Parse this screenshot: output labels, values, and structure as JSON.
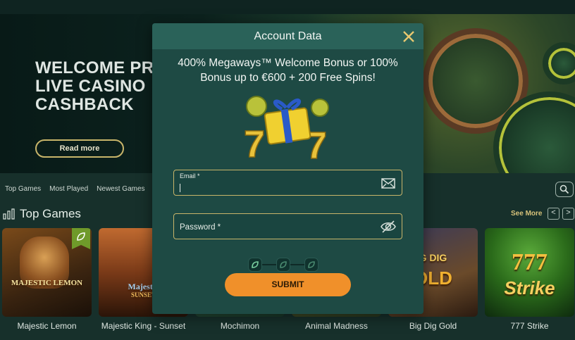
{
  "hero": {
    "headline_lines": [
      "WELCOME PRE",
      "LIVE CASINO",
      "CASHBACK"
    ],
    "read_more_label": "Read more"
  },
  "nav": {
    "tabs": [
      "Top Games",
      "Most Played",
      "Newest Games",
      "F"
    ]
  },
  "section": {
    "title": "Top Games",
    "see_more_label": "See More",
    "prev_arrow": "<",
    "next_arrow": ">"
  },
  "games": [
    {
      "name": "Majestic Lemon",
      "logo": "MAJESTIC LEMON",
      "colors": [
        "#3a2410",
        "#c07a2a"
      ]
    },
    {
      "name": "Majestic King - Sunset",
      "logo": "Majestic",
      "logo2": "SUNSET",
      "colors": [
        "#4a1a10",
        "#d07a30"
      ]
    },
    {
      "name": "Mochimon",
      "logo": "",
      "colors": [
        "#1a3a2a",
        "#2a5a3a"
      ]
    },
    {
      "name": "Animal Madness",
      "logo": "",
      "colors": [
        "#3a3a20",
        "#6a6a30"
      ]
    },
    {
      "name": "Big Dig Gold",
      "logo": "G DIG",
      "logo2": "OLD",
      "colors": [
        "#2a2a40",
        "#7a5a30"
      ]
    },
    {
      "name": "777 Strike",
      "logo": "777",
      "logo2": "Strike",
      "colors": [
        "#1a4a1a",
        "#3a8a2a"
      ]
    }
  ],
  "modal": {
    "title": "Account Data",
    "promo_line1": "400% Megaways™ Welcome Bonus or 100%",
    "promo_line2": "Bonus up to €600 + 200 Free Spins!",
    "email_label": "Email *",
    "email_value": "",
    "password_placeholder": "Password *",
    "submit_label": "SUBMIT"
  },
  "colors": {
    "accent_gold": "#c8b56a",
    "submit_orange": "#f0902a",
    "modal_bg": "#1e4a44",
    "modal_header": "#2a6259"
  },
  "icons": [
    "close-icon",
    "email-icon",
    "eye-off-icon",
    "search-icon",
    "bar-chart-icon",
    "leaf-icon",
    "gift-icon"
  ]
}
